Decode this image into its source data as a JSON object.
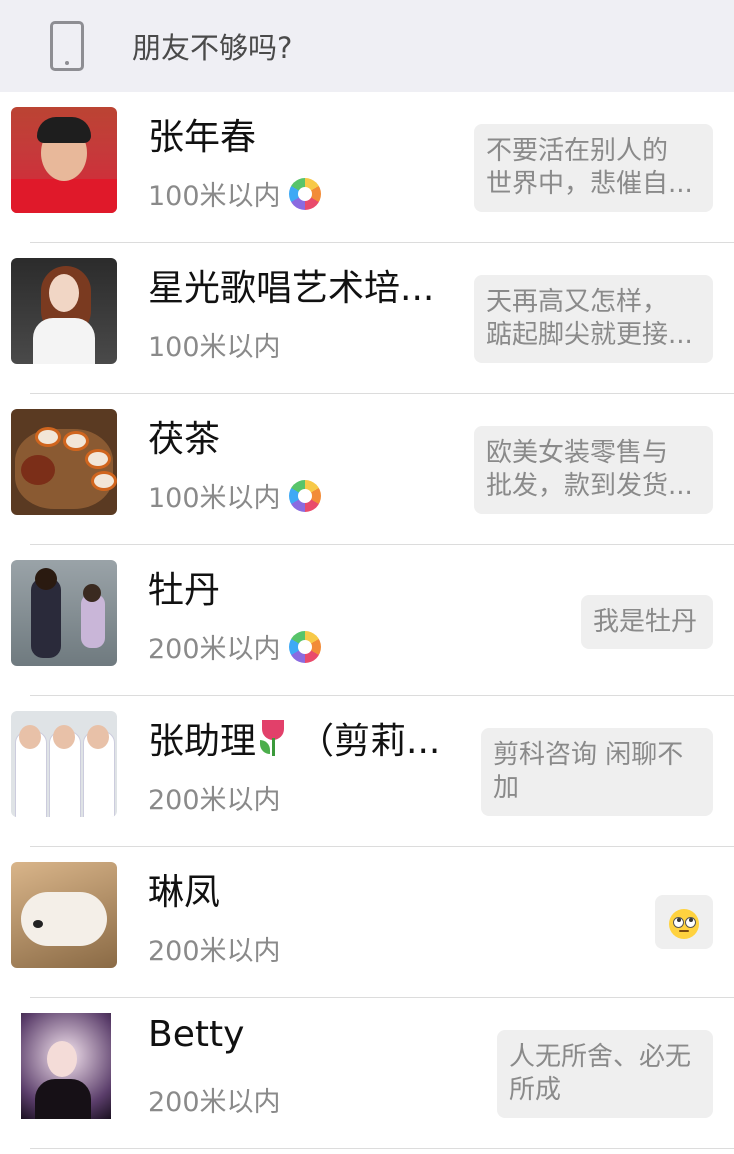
{
  "header": {
    "icon": "phone-icon",
    "title": "朋友不够吗?"
  },
  "people": [
    {
      "name": "张年春",
      "distance": "100米以内",
      "has_moments_icon": true,
      "signature_lines": [
        "不要活在别人的",
        "世界中，悲催自..."
      ]
    },
    {
      "name": "星光歌唱艺术培...",
      "distance": "100米以内",
      "has_moments_icon": false,
      "signature_lines": [
        "天再高又怎样，",
        "踮起脚尖就更接..."
      ]
    },
    {
      "name": "茯茶",
      "distance": "100米以内",
      "has_moments_icon": true,
      "signature_lines": [
        "欧美女装零售与",
        "批发，款到发货..."
      ]
    },
    {
      "name": "牡丹",
      "distance": "200米以内",
      "has_moments_icon": true,
      "signature_lines": [
        "我是牡丹"
      ]
    },
    {
      "name_part1": "张助理",
      "name_emoji": "tulip-emoji",
      "name_part2": "（剪莉...",
      "distance": "200米以内",
      "has_moments_icon": false,
      "signature_lines": [
        "剪科咨询  闲聊不",
        "加"
      ]
    },
    {
      "name": "琳凤",
      "distance": "200米以内",
      "has_moments_icon": false,
      "signature_emoji": "eye-roll-emoji"
    },
    {
      "name": "Betty",
      "distance": "200米以内",
      "has_moments_icon": false,
      "signature_lines": [
        "人无所舍、必无",
        "所成"
      ]
    }
  ]
}
